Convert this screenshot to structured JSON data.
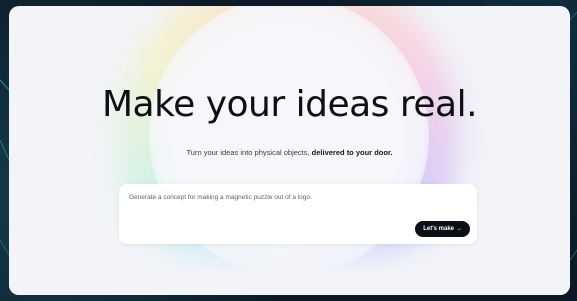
{
  "hero": {
    "title": "Make your ideas real.",
    "subtitle_lead": "Turn your ideas into physical objects, ",
    "subtitle_emphasis": "delivered to your door."
  },
  "prompt": {
    "value": "Generate a concept for making a magnetic puzzle out of a logo.",
    "button_label": "Let's make",
    "button_icon": "arrow-right-icon"
  },
  "colors": {
    "backdrop": "#0b1a26",
    "card": "#f2f4f8",
    "button_bg": "#0d0f16",
    "button_text": "#ffffff",
    "headline": "#0e0f14"
  }
}
